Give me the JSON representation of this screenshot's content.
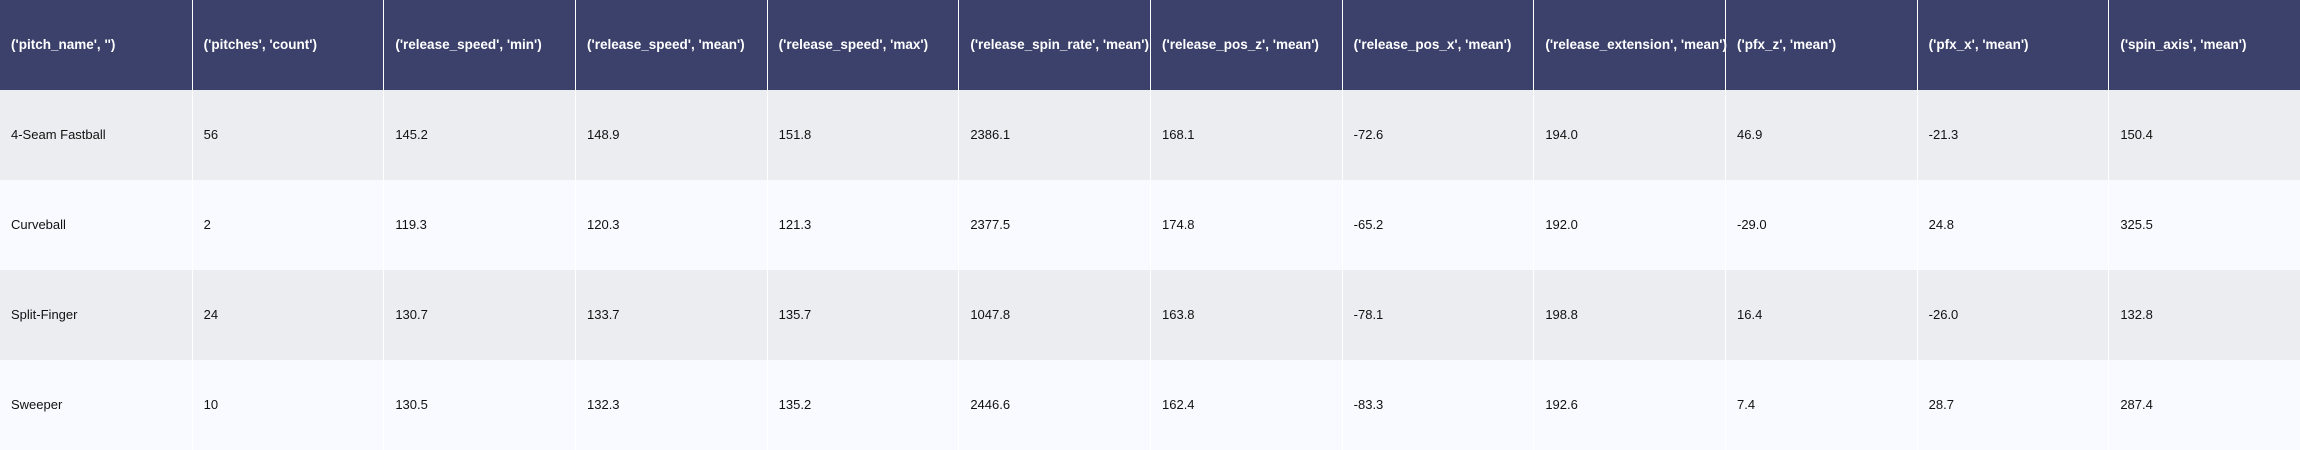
{
  "colors": {
    "header_bg": "#3b416b",
    "row_odd_bg": "#ecedf0",
    "row_even_bg": "#f9faff",
    "header_text": "#ffffff",
    "body_text": "#111111",
    "column_divider": "#ffffff"
  },
  "chart_data": {
    "type": "table",
    "columns": [
      "('pitch_name', '')",
      "('pitches', 'count')",
      "('release_speed', 'min')",
      "('release_speed', 'mean')",
      "('release_speed', 'max')",
      "('release_spin_rate', 'mean')",
      "('release_pos_z', 'mean')",
      "('release_pos_x', 'mean')",
      "('release_extension', 'mean')",
      "('pfx_z', 'mean')",
      "('pfx_x', 'mean')",
      "('spin_axis', 'mean')"
    ],
    "rows": [
      [
        "4-Seam Fastball",
        "56",
        "145.2",
        "148.9",
        "151.8",
        "2386.1",
        "168.1",
        "-72.6",
        "194.0",
        "46.9",
        "-21.3",
        "150.4"
      ],
      [
        "Curveball",
        "2",
        "119.3",
        "120.3",
        "121.3",
        "2377.5",
        "174.8",
        "-65.2",
        "192.0",
        "-29.0",
        "24.8",
        "325.5"
      ],
      [
        "Split-Finger",
        "24",
        "130.7",
        "133.7",
        "135.7",
        "1047.8",
        "163.8",
        "-78.1",
        "198.8",
        "16.4",
        "-26.0",
        "132.8"
      ],
      [
        "Sweeper",
        "10",
        "130.5",
        "132.3",
        "135.2",
        "2446.6",
        "162.4",
        "-83.3",
        "192.6",
        "7.4",
        "28.7",
        "287.4"
      ]
    ]
  }
}
